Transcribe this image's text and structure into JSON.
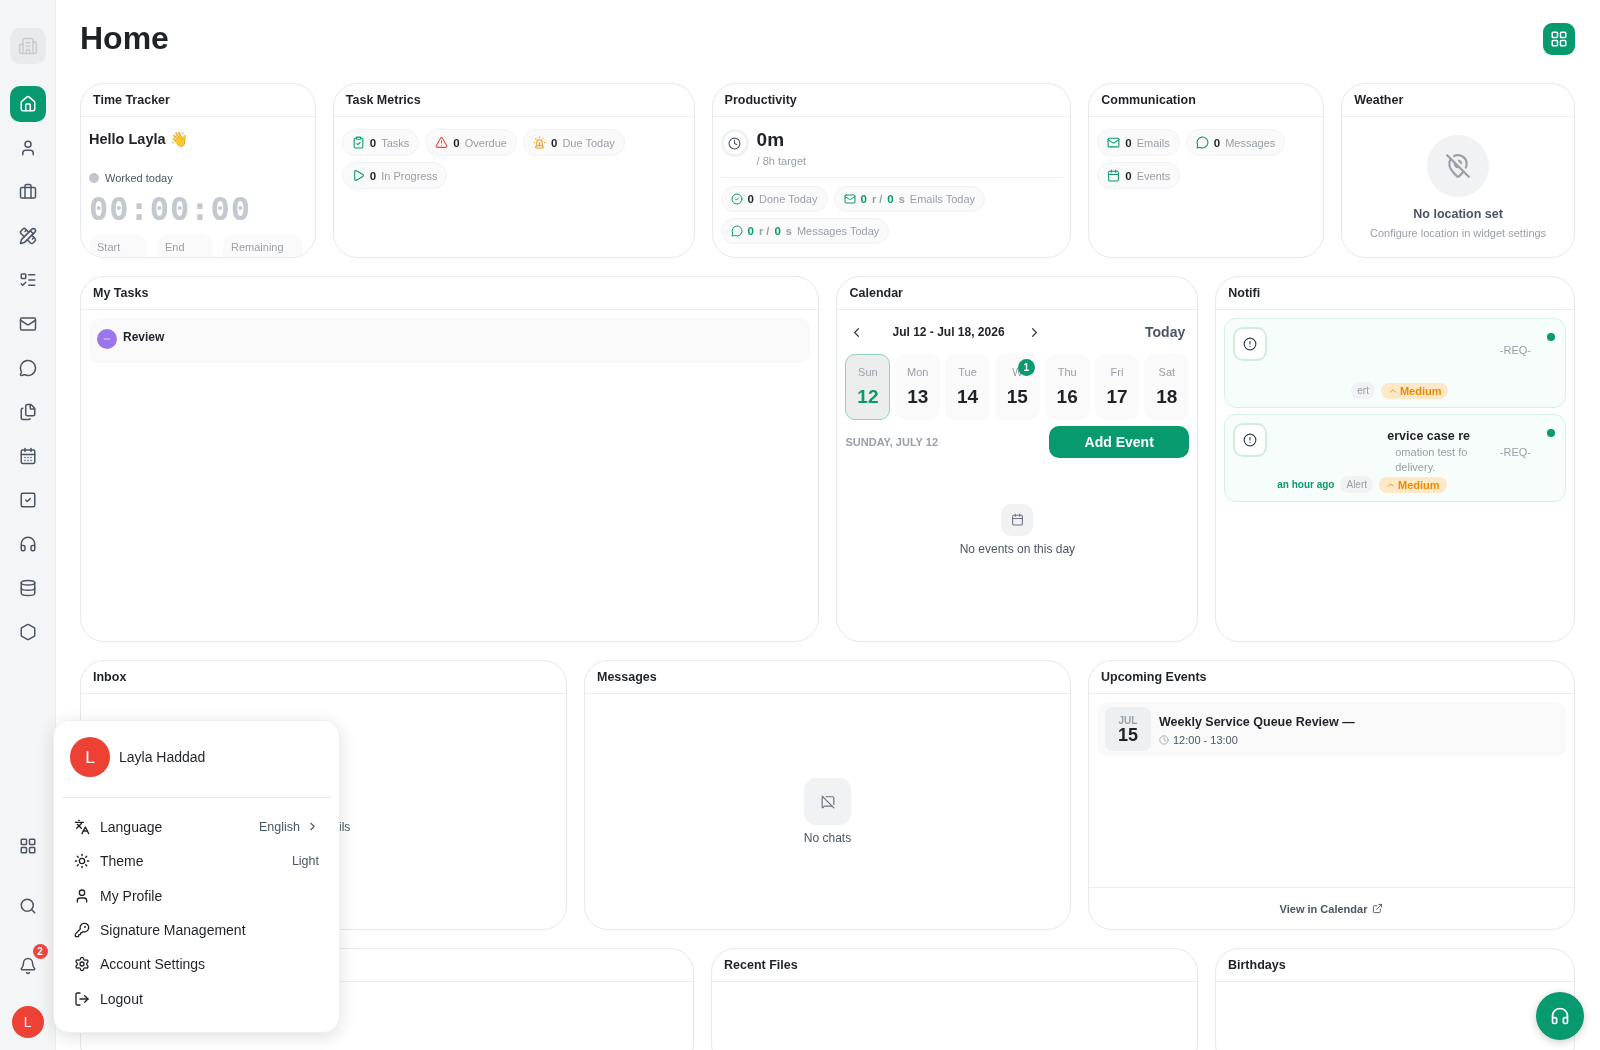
{
  "page": {
    "title": "Home"
  },
  "sidebar": {
    "items": [
      {
        "selected": true
      },
      {
        "selected": false
      },
      {
        "selected": false
      },
      {
        "selected": false
      },
      {
        "selected": false
      },
      {
        "selected": false
      },
      {
        "selected": false
      },
      {
        "selected": false
      },
      {
        "selected": false
      },
      {
        "selected": false
      },
      {
        "selected": false
      },
      {
        "selected": false
      },
      {
        "selected": false
      }
    ],
    "notification_badge": "2",
    "avatar": "L"
  },
  "time_tracker": {
    "title": "Time Tracker",
    "greeting": "Hello Layla 👋",
    "status": "Worked today",
    "active": false,
    "clock": "00:00:00",
    "pills": [
      "Start",
      "End",
      "Remaining"
    ]
  },
  "task_metrics": {
    "title": "Task Metrics",
    "items": [
      {
        "value": "0",
        "label": "Tasks"
      },
      {
        "value": "0",
        "label": "Overdue"
      },
      {
        "value": "0",
        "label": "Due Today"
      },
      {
        "value": "0",
        "label": "In Progress"
      }
    ]
  },
  "productivity": {
    "title": "Productivity",
    "total": "0m",
    "target": "/ 8h target",
    "stats": [
      {
        "kind": "plain",
        "value": "0",
        "label": "Done Today"
      },
      {
        "kind": "split",
        "received": "0",
        "received_unit": "r /",
        "sent": "0",
        "sent_unit": "s",
        "label": "Emails Today"
      },
      {
        "kind": "split",
        "received": "0",
        "received_unit": "r /",
        "sent": "0",
        "sent_unit": "s",
        "label": "Messages Today"
      }
    ]
  },
  "communication": {
    "title": "Communication",
    "items": [
      {
        "value": "0",
        "label": "Emails"
      },
      {
        "value": "0",
        "label": "Messages"
      },
      {
        "value": "0",
        "label": "Events"
      }
    ]
  },
  "weather": {
    "title": "Weather",
    "heading": "No location set",
    "hint": "Configure location in widget settings"
  },
  "my_tasks": {
    "title": "My Tasks",
    "tasks": [
      {
        "title": "Review"
      }
    ]
  },
  "calendar": {
    "title": "Calendar",
    "range": "Jul 12 - Jul 18, 2026",
    "today_button": "Today",
    "days": [
      {
        "dow": "Sun",
        "date": "12",
        "selected": true
      },
      {
        "dow": "Mon",
        "date": "13",
        "selected": false
      },
      {
        "dow": "Tue",
        "date": "14",
        "selected": false
      },
      {
        "dow": "W",
        "date": "15",
        "selected": false,
        "badge": "1"
      },
      {
        "dow": "Thu",
        "date": "16",
        "selected": false
      },
      {
        "dow": "Fri",
        "date": "17",
        "selected": false
      },
      {
        "dow": "Sat",
        "date": "18",
        "selected": false
      }
    ],
    "selected_label": "SUNDAY, JULY 12",
    "add_button": "Add Event",
    "empty": "No events on this day"
  },
  "notifications": {
    "title": "Notifi",
    "items": [
      {
        "unread": true,
        "lines": [
          {
            "tail": "-REQ-"
          }
        ],
        "type": "ert",
        "priority": "Medium"
      },
      {
        "unread": true,
        "title": "ervice case re",
        "lines": [
          {
            "lead": "omation test fo",
            "tail": "-REQ-"
          },
          {
            "lead": "delivery."
          }
        ],
        "time": "an hour ago",
        "type": "Alert",
        "priority": "Medium"
      }
    ]
  },
  "inbox": {
    "title": "Inbox",
    "empty": "ils"
  },
  "messages": {
    "title": "Messages",
    "empty": "No chats"
  },
  "upcoming_events": {
    "title": "Upcoming Events",
    "events": [
      {
        "month": "JUL",
        "day": "15",
        "title": "Weekly Service Queue Review —",
        "time": "12:00 - 13:00"
      }
    ],
    "footer_link": "View in Calendar"
  },
  "bottom_row": [
    {
      "title": "Recent Files"
    },
    {
      "title": "Birthdays"
    }
  ],
  "user_menu": {
    "name": "Layla Haddad",
    "avatar": "L",
    "items": [
      {
        "label": "Language",
        "value": "English",
        "submenu": true
      },
      {
        "label": "Theme",
        "value": "Light",
        "submenu": false
      },
      {
        "label": "My Profile"
      },
      {
        "label": "Signature Management"
      },
      {
        "label": "Account Settings"
      },
      {
        "label": "Logout"
      }
    ]
  }
}
